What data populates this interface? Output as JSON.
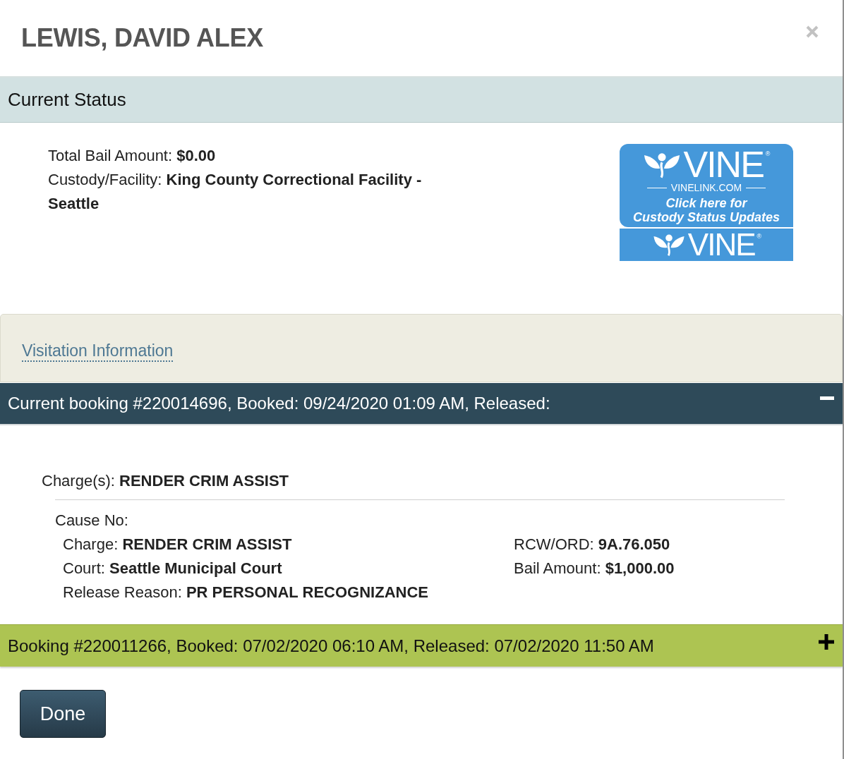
{
  "dialog": {
    "title": "LEWIS, DAVID ALEX"
  },
  "current_status": {
    "heading": "Current Status",
    "lines": [
      "Total Bail Amount: **$0.00**",
      "Custody/Facility: **King County Correctional Facility - Seattle**"
    ],
    "vine_banner": {
      "wordmark": "VINE$^{®}$",
      "site": "VINELINK.COM",
      "caption": [
        "Click here for",
        "Custody Status Updates"
      ]
    },
    "vine_bar": {
      "wordmark": "VINE$^{®}$"
    }
  },
  "visitation": {
    "link": "Visitation Information"
  },
  "bookings": [
    {
      "header": "Current booking #220014696, Booked: 09/24/2020 01:09 AM, Released:",
      "current": true,
      "expanded": true,
      "charges": "Charge(s): **RENDER CRIM ASSIST**",
      "cause": "Cause No:",
      "details_left": [
        "Charge: **RENDER CRIM ASSIST**",
        "Court: **Seattle Municipal Court**",
        "Release Reason: **PR PERSONAL RECOGNIZANCE**"
      ],
      "details_right": [
        "RCW/ORD: **9A.76.050**",
        "Bail Amount: **$1,000.00**"
      ]
    },
    {
      "header": "Booking #220011266, Booked: 07/02/2020 06:10 AM, Released: 07/02/2020 11:50 AM",
      "current": false,
      "expanded": false
    }
  ],
  "done_button": "Done"
}
